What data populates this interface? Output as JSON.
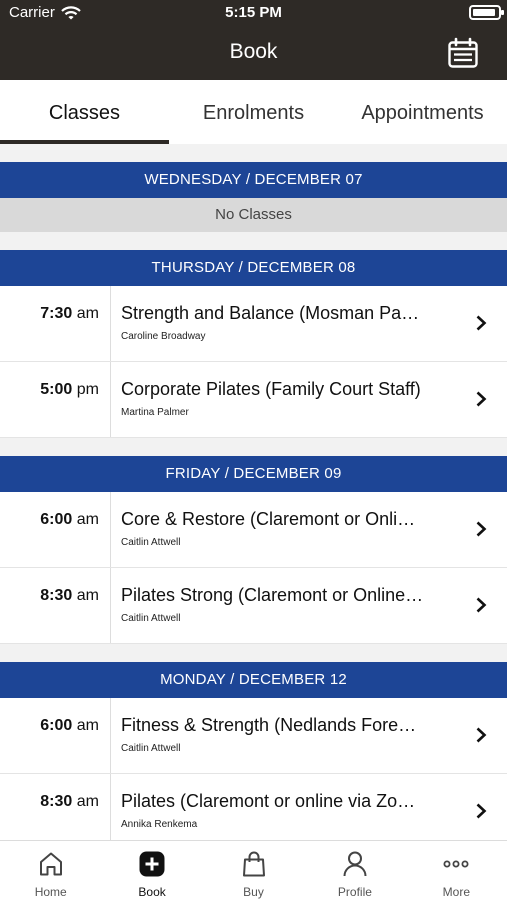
{
  "status_bar": {
    "carrier": "Carrier",
    "time": "5:15 PM"
  },
  "header": {
    "title": "Book",
    "calendar_icon": "calendar-icon"
  },
  "tabs": [
    {
      "label": "Classes",
      "active": true
    },
    {
      "label": "Enrolments",
      "active": false
    },
    {
      "label": "Appointments",
      "active": false
    }
  ],
  "days": [
    {
      "header": "WEDNESDAY / DECEMBER 07",
      "no_classes": "No Classes"
    },
    {
      "header": "THURSDAY / DECEMBER 08",
      "classes": [
        {
          "time": "7:30",
          "ampm": "am",
          "title": "Strength and Balance (Mosman Pa…",
          "instructor": "Caroline Broadway"
        },
        {
          "time": "5:00",
          "ampm": "pm",
          "title": "Corporate Pilates (Family Court Staff)",
          "instructor": "Martina Palmer"
        }
      ]
    },
    {
      "header": "FRIDAY / DECEMBER 09",
      "classes": [
        {
          "time": "6:00",
          "ampm": "am",
          "title": "Core & Restore (Claremont or Onli…",
          "instructor": "Caitlin Attwell"
        },
        {
          "time": "8:30",
          "ampm": "am",
          "title": "Pilates Strong (Claremont or Online…",
          "instructor": "Caitlin Attwell"
        }
      ]
    },
    {
      "header": "MONDAY / DECEMBER 12",
      "classes": [
        {
          "time": "6:00",
          "ampm": "am",
          "title": "Fitness & Strength (Nedlands Fore…",
          "instructor": "Caitlin Attwell"
        },
        {
          "time": "8:30",
          "ampm": "am",
          "title": "Pilates (Claremont or online via Zo…",
          "instructor": "Annika Renkema"
        }
      ]
    }
  ],
  "bottom_nav": [
    {
      "label": "Home",
      "icon": "home-icon"
    },
    {
      "label": "Book",
      "icon": "add-icon",
      "active": true
    },
    {
      "label": "Buy",
      "icon": "shopping-bag-icon"
    },
    {
      "label": "Profile",
      "icon": "person-icon"
    },
    {
      "label": "More",
      "icon": "more-icon"
    }
  ],
  "colors": {
    "header_bg": "#2e2a26",
    "day_header_bg": "#1d4596",
    "no_classes_bg": "#d9d9d9"
  }
}
